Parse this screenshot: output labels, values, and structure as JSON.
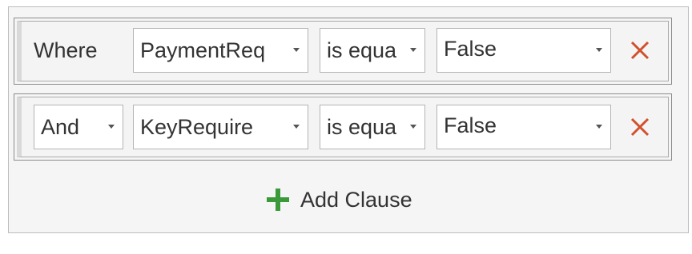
{
  "clauses": [
    {
      "connector": "Where",
      "field": "PaymentReq",
      "operator": "is equa",
      "value": "False"
    },
    {
      "connector": "And",
      "field": "KeyRequire",
      "operator": "is equa",
      "value": "False"
    }
  ],
  "add_clause": {
    "label": "Add Clause",
    "icon": "plus-icon"
  },
  "icons": {
    "remove": "close-icon",
    "dropdown": "chevron-down-icon"
  },
  "colors": {
    "remove": "#d0512b",
    "add": "#3a9a3a"
  }
}
